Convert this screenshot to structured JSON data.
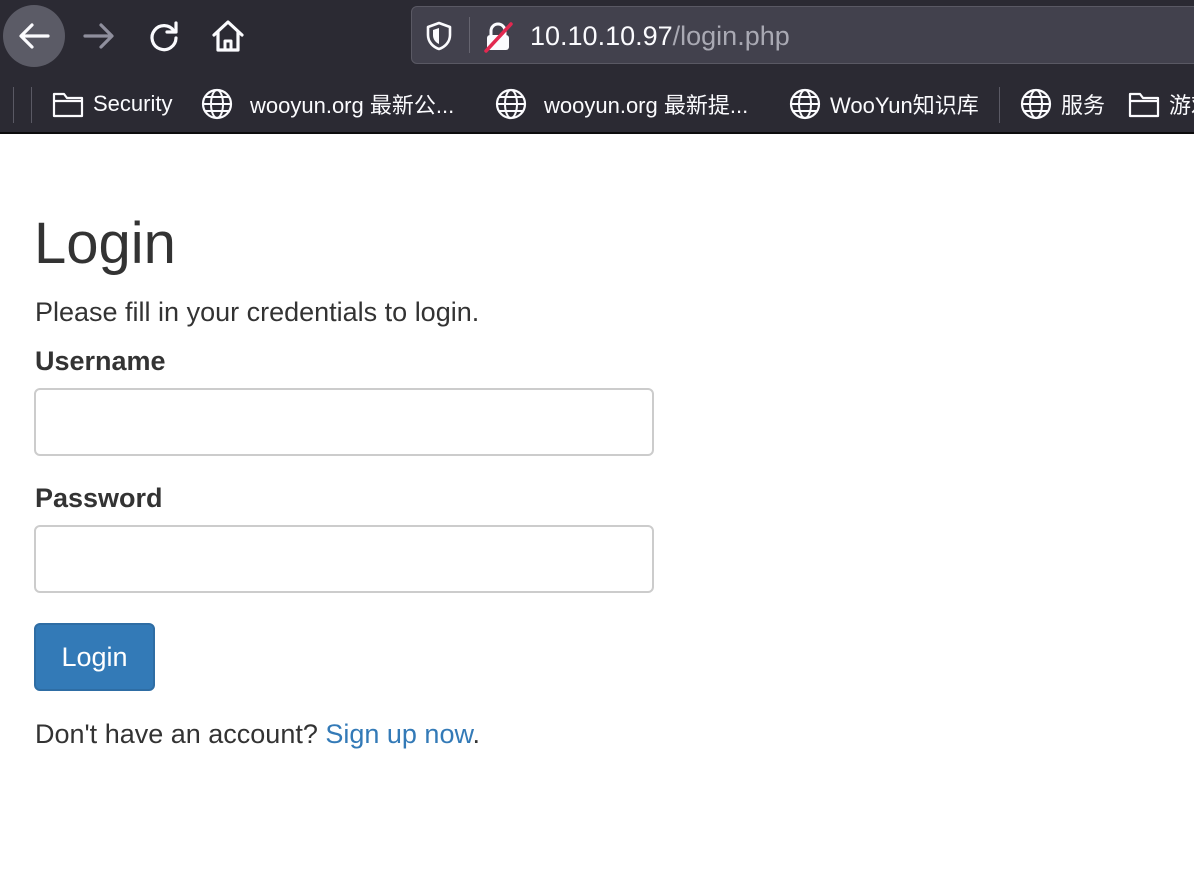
{
  "browser": {
    "url": {
      "host": "10.10.10.97",
      "path": "/login.php"
    },
    "icons": {
      "back": "back-arrow-icon",
      "forward": "forward-arrow-icon",
      "reload": "reload-icon",
      "home": "home-icon",
      "tracking_protection": "shield-icon",
      "insecure_connection": "insecure-lock-icon"
    },
    "bookmarks": [
      {
        "label": "Security",
        "icon": "folder-icon"
      },
      {
        "label": "wooyun.org 最新公...",
        "icon": "globe-icon"
      },
      {
        "label": "wooyun.org 最新提...",
        "icon": "globe-icon"
      },
      {
        "label": "WooYun知识库",
        "icon": "globe-icon"
      },
      {
        "label": "服务",
        "icon": "globe-icon"
      },
      {
        "label": "游戏",
        "icon": "folder-icon"
      }
    ]
  },
  "page": {
    "title": "Login",
    "subtitle": "Please fill in your credentials to login.",
    "username_label": "Username",
    "username_value": "",
    "password_label": "Password",
    "password_value": "",
    "login_button": "Login",
    "signup_prompt": "Don't have an account? ",
    "signup_link": "Sign up now",
    "signup_suffix": "."
  },
  "colors": {
    "chrome_bg": "#2b2a33",
    "urlbar_bg": "#42414d",
    "text": "#333333",
    "primary": "#337ab7",
    "insecure_red": "#e22850"
  }
}
